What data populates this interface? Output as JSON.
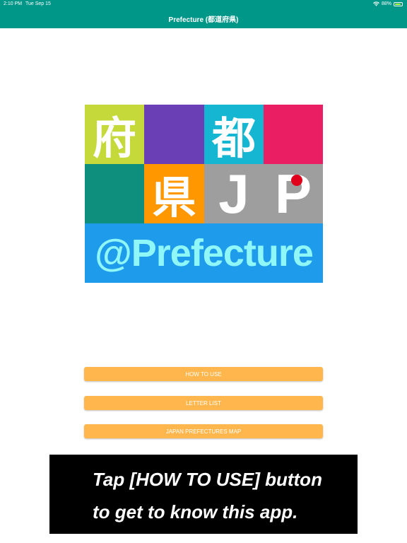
{
  "status_bar": {
    "time": "2:10 PM",
    "date": "Tue Sep 15",
    "battery_text": "88%",
    "battery_level": 0.88
  },
  "nav": {
    "title": "Prefecture (都道府県)"
  },
  "logo": {
    "row1": [
      "府",
      "",
      "都",
      ""
    ],
    "row2": [
      "",
      "県",
      "J",
      "P"
    ],
    "banner": "@Prefecture",
    "colors": [
      "#c6d93b",
      "#6a3fb6",
      "#14b6d2",
      "#e91e63",
      "#0e8f7e",
      "#ff9800",
      "#9e9e9e",
      "#9e9e9e",
      "#1e9bea"
    ]
  },
  "buttons": {
    "how_to_use": "HOW TO USE",
    "letter_list": "LETTER LIST",
    "map": "JAPAN PREFECTURES MAP"
  },
  "tip": {
    "line1": "Tap [HOW TO USE] button",
    "line2": "to get to know this app."
  }
}
